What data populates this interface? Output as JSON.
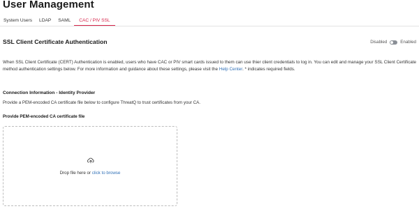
{
  "page": {
    "title": "User Management"
  },
  "tabs": [
    {
      "label": "System Users"
    },
    {
      "label": "LDAP"
    },
    {
      "label": "SAML"
    },
    {
      "label": "CAC / PIV SSL",
      "active": true
    }
  ],
  "section": {
    "heading": "SSL Client Certificate Authentication",
    "toggle": {
      "off_label": "Disabled",
      "on_label": "Enabled",
      "state": "disabled"
    },
    "description_pre": "When SSL Client Certificate (CERT) Authentication is enabled, users who have CAC or PIV smart cards issued to them can use thier client credentials to log in. You can edit and manage your SSL Client Certificate method authentication settings below. For more information and guidance about these settings, please visit the ",
    "help_link": "Help Center",
    "description_post": ". * indicates required fields."
  },
  "connection": {
    "heading": "Connection Information - Identity Provider",
    "subtext": "Provide a PEM-encoded CA certificate file below to configure ThreatQ to trust certificates from your CA.",
    "field_label": "Provide PEM-encoded CA certificate file",
    "drop_text": "Drop file here or ",
    "browse_link": "click to browse",
    "icon": "cloud-upload-icon"
  },
  "colors": {
    "accent": "#d6244a",
    "link": "#2f6fb6"
  }
}
